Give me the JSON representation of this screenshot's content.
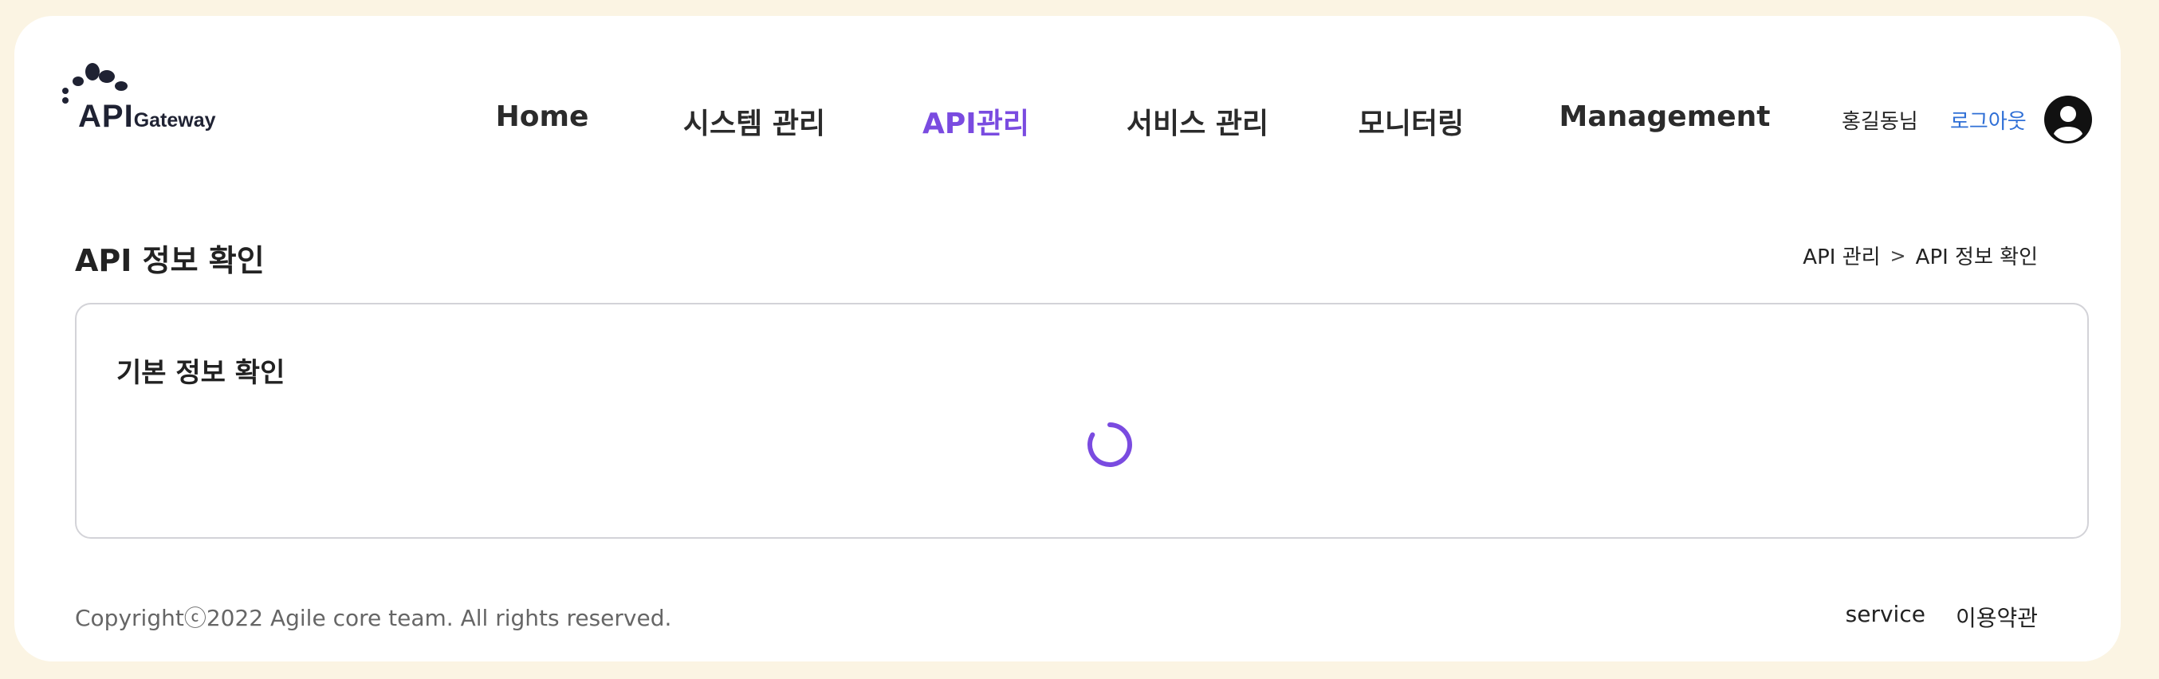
{
  "header": {
    "logo": {
      "api": "API",
      "gateway": "Gateway"
    },
    "nav": [
      {
        "label": "Home",
        "active": false
      },
      {
        "label": "시스템 관리",
        "active": false
      },
      {
        "label": "API관리",
        "active": true
      },
      {
        "label": "서비스 관리",
        "active": false
      },
      {
        "label": "모니터링",
        "active": false
      },
      {
        "label": "Management",
        "active": false
      }
    ],
    "user_name": "홍길동님",
    "logout_label": "로그아웃",
    "avatar_icon": "user-circle-icon"
  },
  "page": {
    "title": "API 정보 확인",
    "breadcrumb": [
      "API 관리",
      "API 정보 확인"
    ],
    "breadcrumb_separator": ">"
  },
  "info_box": {
    "title": "기본 정보 확인",
    "loading": true,
    "spinner_icon": "loading-spinner-icon"
  },
  "footer": {
    "copyright": "Copyrightⓒ2022 Agile core team. All rights reserved.",
    "links": [
      "service",
      "이용약관"
    ]
  },
  "colors": {
    "background": "#fbf4e3",
    "accent": "#7a4be0",
    "link": "#2f6fd6",
    "text": "#222222"
  }
}
